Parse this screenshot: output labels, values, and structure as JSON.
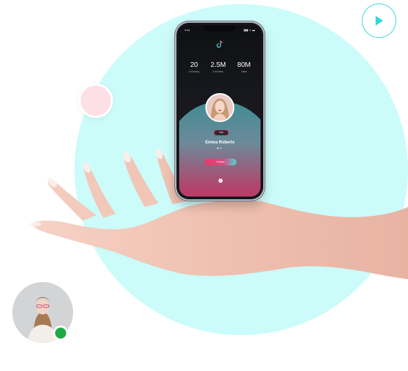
{
  "phone": {
    "status_time": "9:41",
    "status_icons": "▮▮▮ ᯤ ▬",
    "stats": [
      {
        "value": "20",
        "label": "Following"
      },
      {
        "value": "2.5M",
        "label": "Followers"
      },
      {
        "value": "80M",
        "label": "Likes"
      }
    ],
    "live_label": "Live",
    "profile_name": "Emma Roberts",
    "follow_label": "Follow",
    "close_glyph": "×"
  },
  "colors": {
    "bg_circle": "#cbfcfa",
    "accent_pink": "#e93a6a",
    "accent_teal": "#33d6de",
    "online": "#1faa44"
  },
  "icons": {
    "play": "play-icon",
    "logo": "tiktok-logo-icon",
    "online": "online-status-icon"
  }
}
